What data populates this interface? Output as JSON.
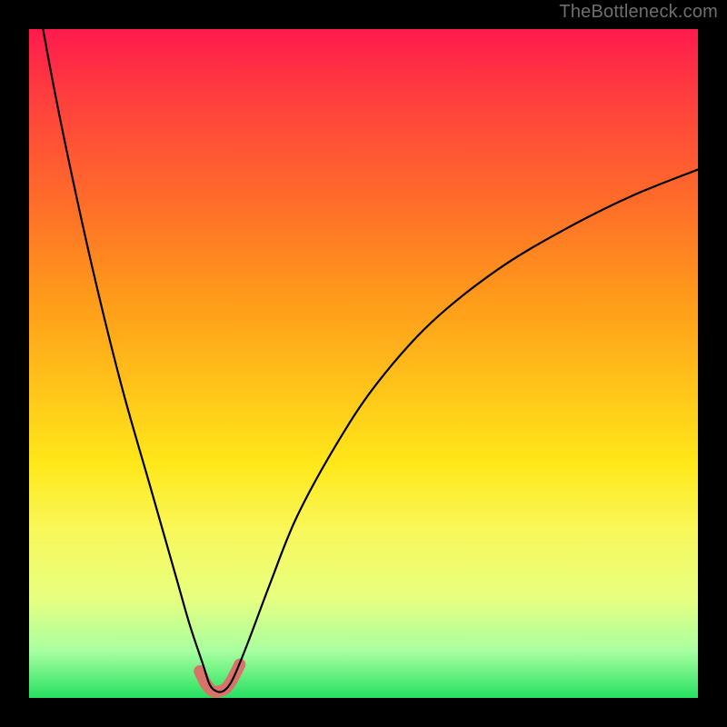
{
  "watermark": "TheBottleneck.com",
  "chart_data": {
    "type": "line",
    "title": "",
    "xlabel": "",
    "ylabel": "",
    "xlim": [
      0,
      100
    ],
    "ylim": [
      0,
      100
    ],
    "series": [
      {
        "name": "bottleneck-curve",
        "x": [
          0,
          3,
          6,
          10,
          14,
          18,
          22,
          24,
          26,
          27,
          28,
          29,
          30,
          31,
          33,
          36,
          40,
          46,
          52,
          60,
          70,
          80,
          90,
          100
        ],
        "y": [
          112,
          95,
          80,
          62,
          46,
          32,
          18,
          11,
          5,
          2,
          1,
          1,
          2,
          4,
          9,
          17,
          27,
          38,
          47,
          56,
          64,
          70,
          75,
          79
        ]
      },
      {
        "name": "trough-highlight",
        "x": [
          25.5,
          26.5,
          27.5,
          28.5,
          29.5,
          30.5,
          31.5
        ],
        "y": [
          4.0,
          2.0,
          1.0,
          1.0,
          1.5,
          3.0,
          5.0
        ]
      }
    ],
    "styles": {
      "bottleneck-curve": {
        "stroke": "#000000",
        "width": 2.2,
        "fill": "none"
      },
      "trough-highlight": {
        "stroke": "#d9736a",
        "width": 13,
        "fill": "none",
        "linecap": "round",
        "linejoin": "round"
      }
    }
  }
}
